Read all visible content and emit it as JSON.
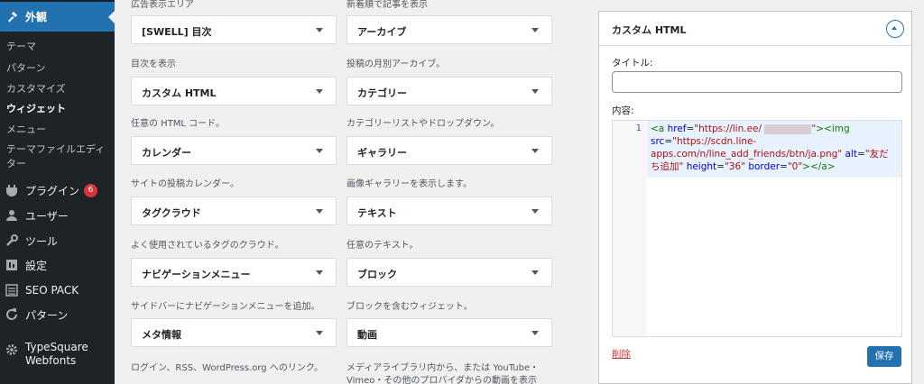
{
  "sidebar": {
    "section": "外観",
    "subitems": [
      "テーマ",
      "パターン",
      "カスタマイズ",
      "ウィジェット",
      "メニュー",
      "テーマファイルエディ",
      "ター"
    ],
    "menu": [
      {
        "label": "プラグイン",
        "badge": "6",
        "icon": "plugin-icon"
      },
      {
        "label": "ユーザー",
        "icon": "user-icon"
      },
      {
        "label": "ツール",
        "icon": "wrench-icon"
      },
      {
        "label": "設定",
        "icon": "settings-icon"
      },
      {
        "label": "SEO PACK",
        "icon": "list-icon"
      },
      {
        "label": "パターン",
        "icon": "refresh-icon"
      },
      {
        "label": "TypeSquare",
        "label2": "Webfonts",
        "icon": "gear-icon"
      }
    ]
  },
  "widgets": {
    "top_left_desc": "広告表示エリア",
    "top_right_desc": "新着順で記事を表示",
    "items": [
      {
        "title": "[SWELL] 目次",
        "desc": "目次を表示"
      },
      {
        "title": "アーカイブ",
        "desc": "投稿の月別アーカイブ。"
      },
      {
        "title": "カスタム HTML",
        "desc": "任意の HTML コード。"
      },
      {
        "title": "カテゴリー",
        "desc": "カテゴリーリストやドロップダウン。"
      },
      {
        "title": "カレンダー",
        "desc": "サイトの投稿カレンダー。"
      },
      {
        "title": "ギャラリー",
        "desc": "画像ギャラリーを表示します。"
      },
      {
        "title": "タグクラウド",
        "desc": "よく使用されているタグのクラウド。"
      },
      {
        "title": "テキスト",
        "desc": "任意のテキスト。"
      },
      {
        "title": "ナビゲーションメニュー",
        "desc": "サイドバーにナビゲーションメニューを追加。"
      },
      {
        "title": "ブロック",
        "desc": "ブロックを含むウィジェット。"
      },
      {
        "title": "メタ情報",
        "desc": "ログイン、RSS、WordPress.org へのリンク。"
      },
      {
        "title": "動画",
        "desc": "メディアライブラリ内から、または YouTube・",
        "desc2": "Vimeo・その他のプロバイダからの動画を表示"
      }
    ]
  },
  "panel": {
    "title": "カスタム HTML",
    "title_label": "タイトル:",
    "title_value": "",
    "content_label": "内容:",
    "line_number": "1",
    "code": {
      "t1": "<a ",
      "a1": "href",
      "eq1": "=",
      "s1": "\"https://lin.ee/",
      "s1end": "\"",
      "t2": "><img",
      "a2": "src",
      "eq2": "=",
      "s2": "\"https://scdn.line-",
      "s3": "apps.com/n/line_add_friends/btn/ja.png\"",
      "a3": "alt",
      "eq3": "=",
      "s4": "\"友だ",
      "s5": "ち追加\"",
      "a4": "height",
      "eq4": "=",
      "s6": "\"36\"",
      "a5": "border",
      "eq5": "=",
      "s7": "\"0\"",
      "t3": "></a>"
    },
    "delete_label": "削除",
    "save_label": "保存"
  }
}
